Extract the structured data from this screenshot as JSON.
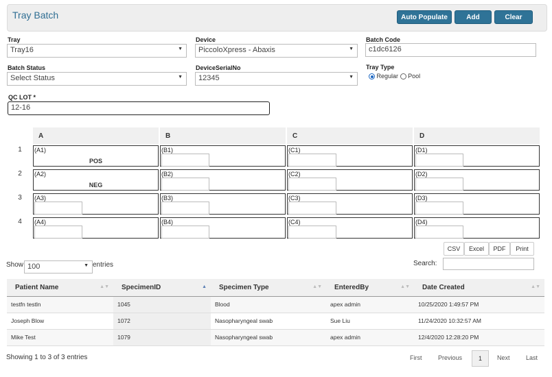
{
  "title": "Tray Batch",
  "buttons": {
    "auto_populate": "Auto Populate",
    "add": "Add",
    "clear": "Clear"
  },
  "form": {
    "tray": {
      "label": "Tray",
      "value": "Tray16"
    },
    "device": {
      "label": "Device",
      "value": "PiccoloXpress - Abaxis"
    },
    "batch_code": {
      "label": "Batch Code",
      "value": "c1dc6126"
    },
    "batch_status": {
      "label": "Batch Status",
      "value": "Select Status"
    },
    "device_serial": {
      "label": "DeviceSerialNo",
      "value": "12345"
    },
    "tray_type": {
      "label": "Tray Type",
      "option_regular": "Regular",
      "option_pool": "Pool",
      "selected": "Regular"
    },
    "qc_lot": {
      "label": "QC LOT *",
      "value": "12-16"
    }
  },
  "tray_grid": {
    "columns": [
      "A",
      "B",
      "C",
      "D"
    ],
    "rows": [
      {
        "num": "1",
        "cells": [
          {
            "label": "(A1)",
            "value": "POS"
          },
          {
            "label": "(B1)"
          },
          {
            "label": "(C1)"
          },
          {
            "label": "(D1)"
          }
        ]
      },
      {
        "num": "2",
        "cells": [
          {
            "label": "(A2)",
            "value": "NEG"
          },
          {
            "label": "(B2)"
          },
          {
            "label": "(C2)"
          },
          {
            "label": "(D2)"
          }
        ]
      },
      {
        "num": "3",
        "cells": [
          {
            "label": "(A3)"
          },
          {
            "label": "(B3)"
          },
          {
            "label": "(C3)"
          },
          {
            "label": "(D3)"
          }
        ]
      },
      {
        "num": "4",
        "cells": [
          {
            "label": "(A4)"
          },
          {
            "label": "(B4)"
          },
          {
            "label": "(C4)"
          },
          {
            "label": "(D4)"
          }
        ]
      }
    ]
  },
  "export_buttons": {
    "csv": "CSV",
    "excel": "Excel",
    "pdf": "PDF",
    "print": "Print"
  },
  "table_controls": {
    "show_label": "Show",
    "show_value": "100",
    "entries_label": "entries",
    "search_label": "Search:"
  },
  "table": {
    "headers": [
      "Patient Name",
      "SpecimenID",
      "Specimen Type",
      "EnteredBy",
      "Date Created"
    ],
    "rows": [
      [
        "testfn testln",
        "1045",
        "Blood",
        "apex admin",
        "10/25/2020 1:49:57 PM"
      ],
      [
        "Joseph Blow",
        "1072",
        "Nasopharyngeal swab",
        "Sue Liu",
        "11/24/2020 10:32:57 AM"
      ],
      [
        "Mike Test",
        "1079",
        "Nasopharyngeal swab",
        "apex admin",
        "12/4/2020 12:28:20 PM"
      ]
    ]
  },
  "pagination": {
    "info": "Showing 1 to 3 of 3 entries",
    "first": "First",
    "previous": "Previous",
    "current": "1",
    "next": "Next",
    "last": "Last"
  },
  "colors": {
    "accent": "#2f7397",
    "title": "#2f6e93"
  }
}
